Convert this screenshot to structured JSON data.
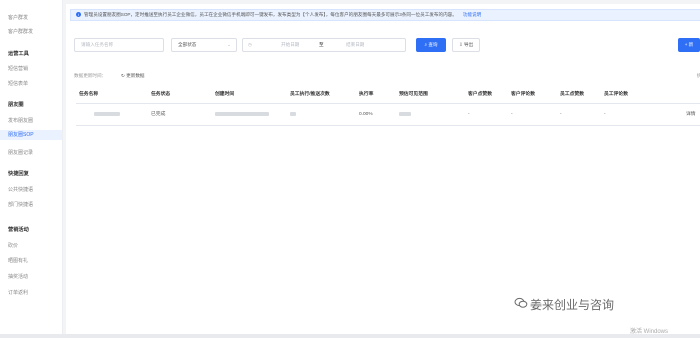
{
  "sidebar": {
    "groups": [
      {
        "title": "",
        "items": [
          "客户群发",
          "客户群群发"
        ]
      },
      {
        "title": "运营工具",
        "items": [
          "短信营销",
          "短信表单"
        ]
      },
      {
        "title": "朋友圈",
        "items": [
          "发布朋友圈",
          "朋友圈SOP",
          "朋友圈记录"
        ]
      },
      {
        "title": "快捷回复",
        "items": [
          "公共快捷语",
          "部门快捷语"
        ]
      },
      {
        "title": "营销活动",
        "items": [
          "砍价",
          "晒图有礼",
          "抽奖活动",
          "订单返利"
        ]
      }
    ],
    "active_item": "朋友圈SOP"
  },
  "notice": {
    "text": "管理员设置朋友圈SOP，定时推送至执行员工企业微信，员工在企业微信手机端即可一键发布，发布类型为【个人发布】，每位客户的朋友圈每天最多可展示3条同一位员工发布的内容。",
    "link": "功能说明"
  },
  "filters": {
    "task_name_placeholder": "请输入任务名称",
    "status_value": "全部状态",
    "date_start_placeholder": "开始日期",
    "date_separator": "至",
    "date_end_placeholder": "结束日期",
    "search_label": "查询",
    "export_label": "导出",
    "new_label": "+ 新"
  },
  "meta": {
    "update_time_label": "数据更新时间：",
    "refresh_label": "更新数据",
    "stats_label": "统计"
  },
  "table": {
    "headers": [
      "任务名称",
      "任务状态",
      "创建时间",
      "员工执行/推送次数",
      "执行率",
      "预估可见范围",
      "客户点赞数",
      "客户评论数",
      "员工点赞数",
      "员工评论数"
    ],
    "rows": [
      {
        "status": "已完成",
        "rate": "0.00%",
        "customer_likes": "-",
        "customer_comments": "-",
        "staff_likes": "-",
        "staff_comments": "-",
        "action": "详情"
      }
    ]
  },
  "watermark": {
    "text": "姜来创业与咨询",
    "activate": "激活 Windows"
  }
}
